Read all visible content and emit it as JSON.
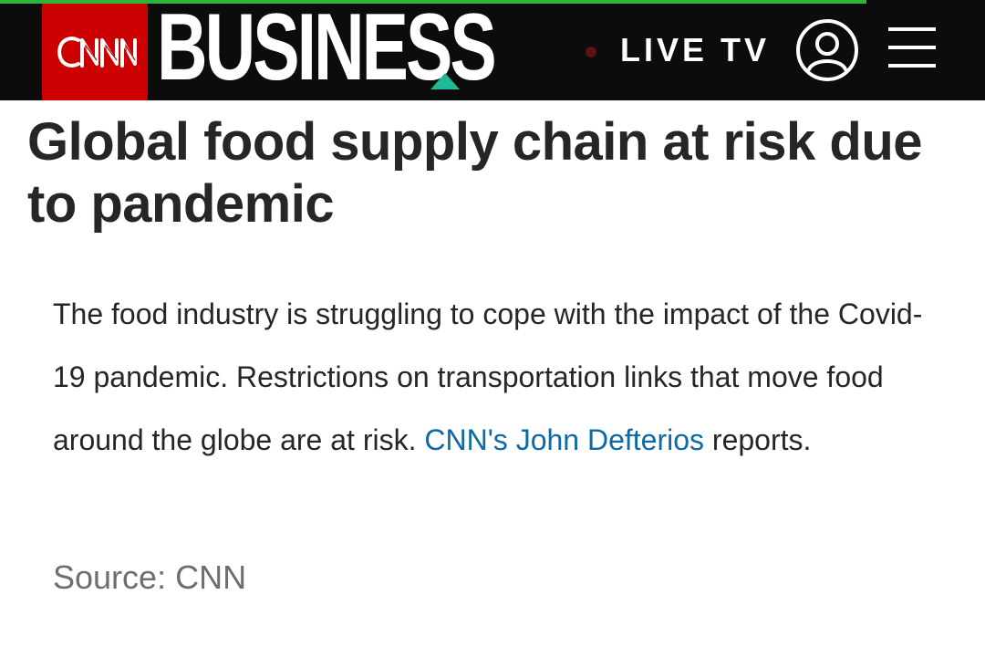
{
  "header": {
    "logo_text": "CNN",
    "section_title": "BUSINESS",
    "live_label": "LIVE TV",
    "profile_icon": "user-profile-icon",
    "menu_icon": "hamburger-menu-icon"
  },
  "article": {
    "headline": "Global food supply chain at risk due to pandemic",
    "body_part1": "The food industry is struggling to cope with the impact of the Covid-19 pandemic. Restrictions on transportation links that move food around the globe are at risk. ",
    "author_link": "CNN's John Defterios",
    "body_part2": " reports.",
    "source": "Source: CNN"
  },
  "colors": {
    "header_bg": "#0c0c0c",
    "cnn_red": "#cc0000",
    "accent_green": "#2fb33a",
    "accent_teal": "#1fb89a",
    "link_blue": "#0c6aa6",
    "text_dark": "#262626",
    "text_gray": "#6e6e6e"
  }
}
